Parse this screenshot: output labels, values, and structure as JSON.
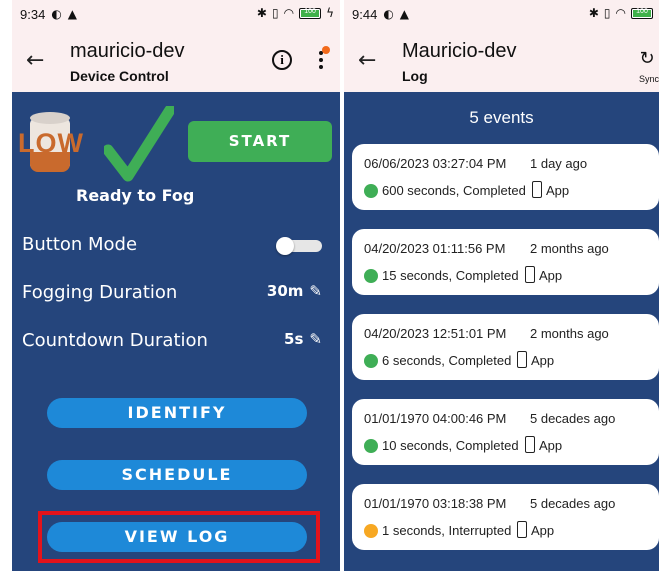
{
  "left": {
    "status": {
      "time": "9:34",
      "battery": "100"
    },
    "appbar": {
      "title": "mauricio-dev",
      "subtitle": "Device Control"
    },
    "low_label": "LOW",
    "start_label": "START",
    "ready_text": "Ready to Fog",
    "button_mode_label": "Button Mode",
    "button_mode_on": false,
    "fogging_label": "Fogging Duration",
    "fogging_value": "30m",
    "countdown_label": "Countdown Duration",
    "countdown_value": "5s",
    "identify_label": "IDENTIFY",
    "schedule_label": "SCHEDULE",
    "view_log_label": "VIEW LOG"
  },
  "right": {
    "status": {
      "time": "9:44",
      "battery": "100"
    },
    "appbar": {
      "title": "Mauricio-dev",
      "subtitle": "Log",
      "sync_label": "Sync"
    },
    "events_count": "5 events",
    "events": [
      {
        "date": "06/06/2023 03:27:04 PM",
        "ago": "1 day ago",
        "result": "600 seconds, Completed",
        "source": "App",
        "status_color": "#3fae56"
      },
      {
        "date": "04/20/2023 01:11:56 PM",
        "ago": "2 months ago",
        "result": "15 seconds, Completed",
        "source": "App",
        "status_color": "#3fae56"
      },
      {
        "date": "04/20/2023 12:51:01 PM",
        "ago": "2 months ago",
        "result": "6 seconds, Completed",
        "source": "App",
        "status_color": "#3fae56"
      },
      {
        "date": "01/01/1970 04:00:46 PM",
        "ago": "5 decades ago",
        "result": "10 seconds, Completed",
        "source": "App",
        "status_color": "#3fae56"
      },
      {
        "date": "01/01/1970 03:18:38 PM",
        "ago": "5 decades ago",
        "result": "1 seconds, Interrupted",
        "source": "App",
        "status_color": "#f7a823"
      }
    ]
  },
  "colors": {
    "background": "#25457c",
    "appbar": "#fbeff0",
    "start": "#3fae56",
    "pill": "#1e89d8",
    "highlight": "#e3131b"
  }
}
